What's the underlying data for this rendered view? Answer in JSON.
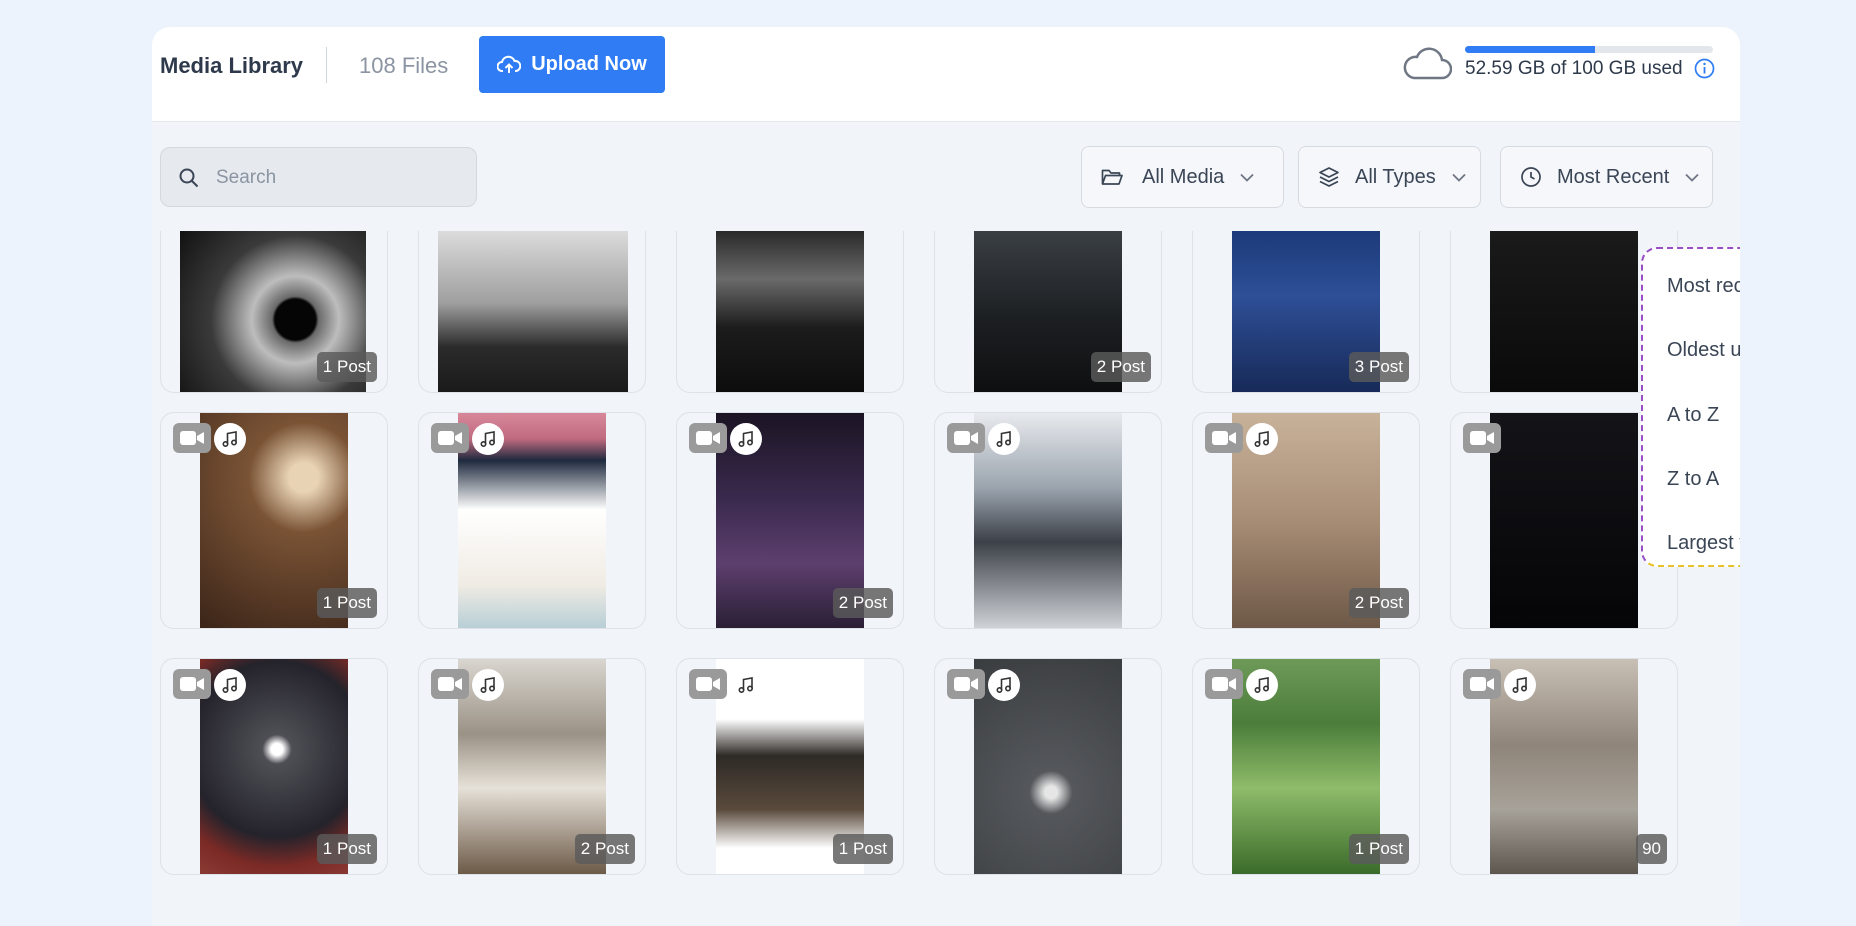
{
  "header": {
    "title": "Media Library",
    "file_count": "108 Files",
    "upload_label": "Upload Now",
    "storage": {
      "used_text": "52.59 GB of 100 GB used",
      "used_fraction": 0.5259,
      "accent": "#2f7cf4"
    }
  },
  "toolbar": {
    "search_placeholder": "Search",
    "filters": [
      {
        "label": "All Media",
        "icon": "folder-icon"
      },
      {
        "label": "All Types",
        "icon": "layers-icon"
      },
      {
        "label": "Most Recent",
        "icon": "clock-icon"
      }
    ]
  },
  "sort_menu": {
    "items": [
      "Most recent",
      "Oldest uploads",
      "A to Z",
      "Z to A",
      "Largest to Smallest"
    ]
  },
  "media_rows": [
    [
      {
        "badge": "1 Post",
        "video": false,
        "music": false
      },
      {
        "badge": "",
        "video": false,
        "music": false
      },
      {
        "badge": "",
        "video": false,
        "music": false
      },
      {
        "badge": "2 Post",
        "video": false,
        "music": false
      },
      {
        "badge": "3 Post",
        "video": false,
        "music": false
      },
      {
        "badge": "",
        "video": false,
        "music": false
      }
    ],
    [
      {
        "badge": "1 Post",
        "video": true,
        "music": true
      },
      {
        "badge": "",
        "video": true,
        "music": true
      },
      {
        "badge": "2 Post",
        "video": true,
        "music": true
      },
      {
        "badge": "",
        "video": true,
        "music": true
      },
      {
        "badge": "2 Post",
        "video": true,
        "music": true
      },
      {
        "badge": "",
        "video": true,
        "music": false
      }
    ],
    [
      {
        "badge": "1 Post",
        "video": true,
        "music": true
      },
      {
        "badge": "2 Post",
        "video": true,
        "music": true
      },
      {
        "badge": "1 Post",
        "video": true,
        "music": true
      },
      {
        "badge": "",
        "video": true,
        "music": true
      },
      {
        "badge": "1 Post",
        "video": true,
        "music": true
      },
      {
        "badge": "90",
        "video": true,
        "music": true
      }
    ]
  ],
  "help_label": "?"
}
